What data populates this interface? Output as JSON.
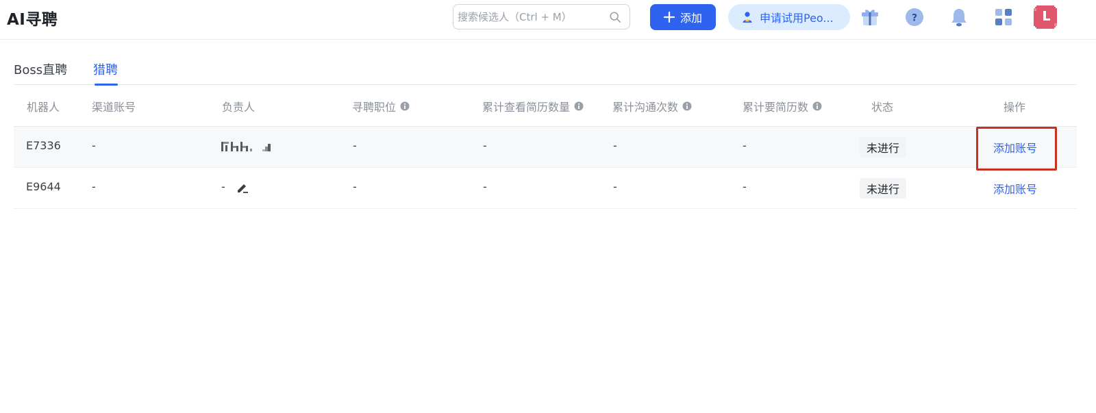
{
  "app": {
    "title": "AI寻聘"
  },
  "search": {
    "placeholder": "搜索候选人（Ctrl + M）",
    "value": ""
  },
  "header": {
    "add_label": "添加",
    "trial_label": "申请试用Peo...",
    "icons": [
      "gift-icon",
      "help-icon",
      "bell-icon",
      "apps-icon",
      "avatar"
    ]
  },
  "tabs": [
    {
      "label": "Boss直聘",
      "active": false
    },
    {
      "label": "猎聘",
      "active": true
    }
  ],
  "table": {
    "columns": [
      "机器人",
      "渠道账号",
      "负责人",
      "寻聘职位",
      "累计查看简历数量",
      "累计沟通次数",
      "累计要简历数",
      "状态",
      "操作"
    ],
    "rows": [
      {
        "robot": "E7336",
        "channel": "-",
        "owner": "",
        "job": "-",
        "views": "-",
        "chats": "-",
        "resumes": "-",
        "status": "未进行",
        "action": "添加账号"
      },
      {
        "robot": "E9644",
        "channel": "-",
        "owner": "-",
        "job": "-",
        "views": "-",
        "chats": "-",
        "resumes": "-",
        "status": "未进行",
        "action": "添加账号"
      }
    ]
  },
  "colors": {
    "primary": "#2e63f0",
    "highlight_box": "#c7311f",
    "trial_bg": "#dcecff",
    "avatar": "#e0566d"
  }
}
